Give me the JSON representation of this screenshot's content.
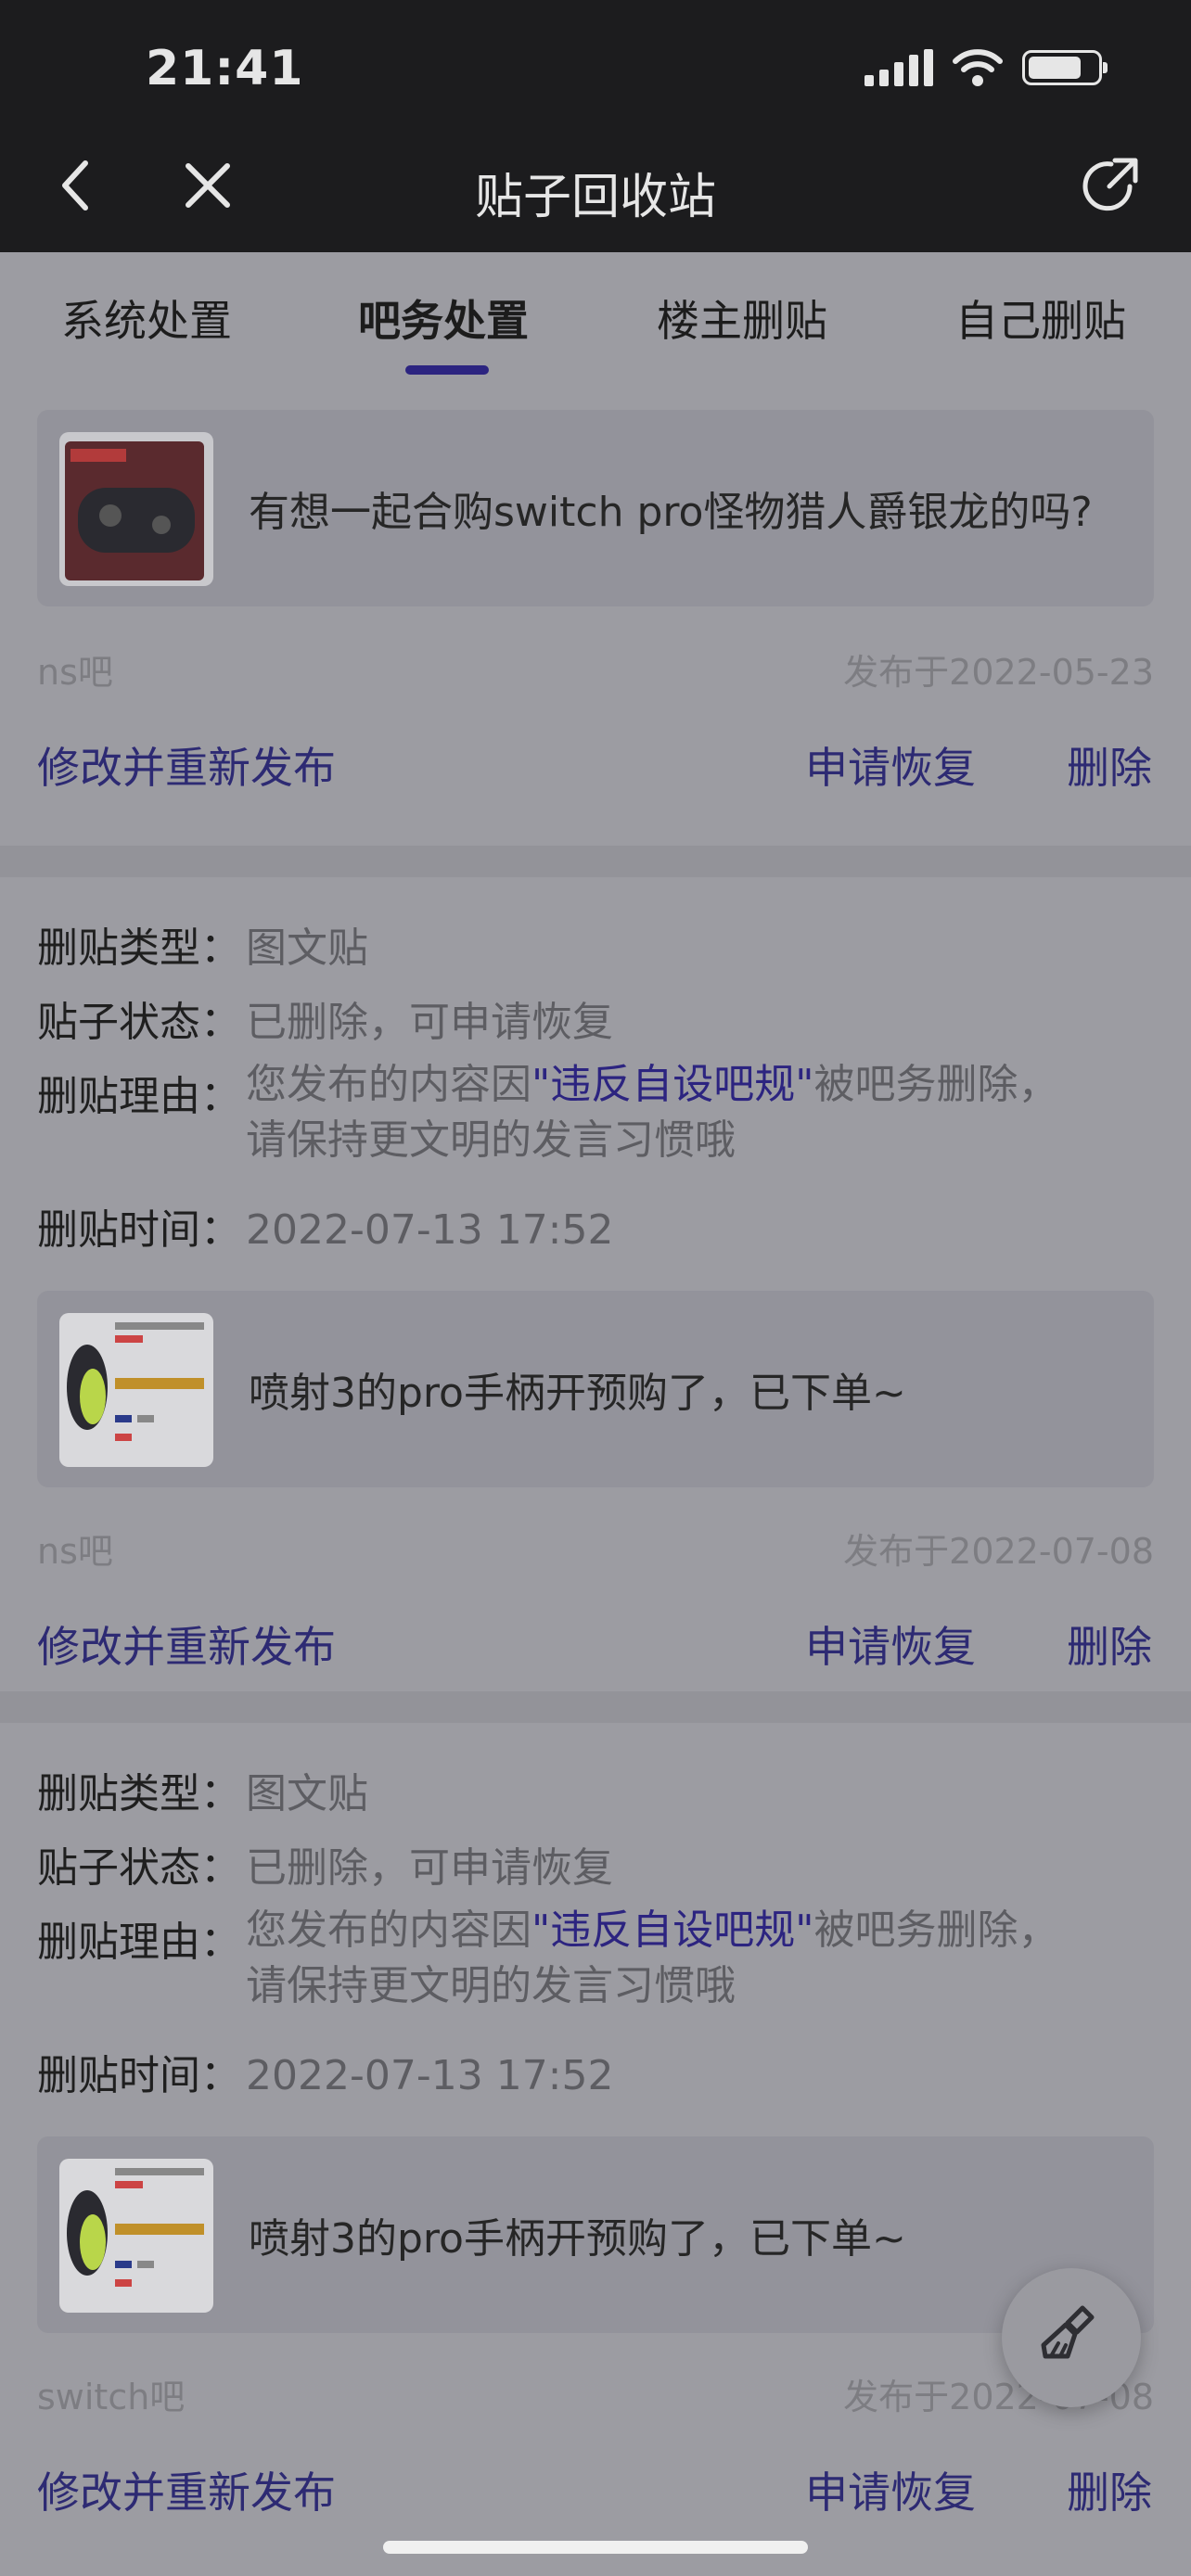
{
  "status": {
    "time": "21:41"
  },
  "nav": {
    "title": "贴子回收站"
  },
  "tabs": [
    {
      "label": "系统处置"
    },
    {
      "label": "吧务处置"
    },
    {
      "label": "楼主删贴"
    },
    {
      "label": "自己删贴"
    }
  ],
  "active_tab": "吧务处置",
  "labels": {
    "type": "删贴类型：",
    "state": "贴子状态：",
    "reason": "删贴理由：",
    "time": "删贴时间：",
    "republish": "修改并重新发布",
    "restore": "申请恢复",
    "delete": "删除"
  },
  "posts": [
    {
      "title": "有想一起合购switch pro怪物猎人爵银龙的吗?",
      "forum": "ns吧",
      "published": "发布于2022-05-23"
    },
    {
      "type": "图文贴",
      "state": "已删除，可申请恢复",
      "reason_prefix": "您发布的内容因",
      "reason_link": "\"违反自设吧规\"",
      "reason_suffix": "被吧务删除，",
      "reason_line2": "请保持更文明的发言习惯哦",
      "delete_time": "2022-07-13 17:52",
      "title": "喷射3的pro手柄开预购了，已下单~",
      "forum": "ns吧",
      "published": "发布于2022-07-08"
    },
    {
      "type": "图文贴",
      "state": "已删除，可申请恢复",
      "reason_prefix": "您发布的内容因",
      "reason_link": "\"违反自设吧规\"",
      "reason_suffix": "被吧务删除，",
      "reason_line2": "请保持更文明的发言习惯哦",
      "delete_time": "2022-07-13 17:52",
      "title": "喷射3的pro手柄开预购了，已下单~",
      "forum": "switch吧",
      "published": "发布于2022-07-08"
    }
  ],
  "icons": {
    "back": "chevron-left-icon",
    "close": "close-icon",
    "share": "share-icon",
    "fab": "broom-icon"
  },
  "colors": {
    "accent": "#2c2480",
    "action": "#2d2a73",
    "overlay_bg": "#9c9ca2"
  }
}
